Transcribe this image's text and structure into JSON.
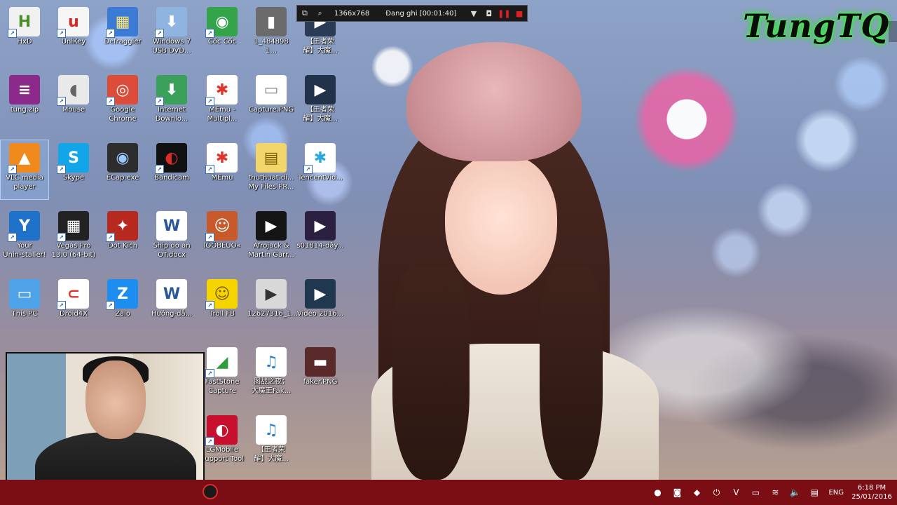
{
  "desktop": {
    "icons": [
      {
        "label": "HxD",
        "glyph": "H",
        "bg": "#f1f1f1",
        "fg": "#4a8f2a",
        "col": 0,
        "row": 0,
        "shortcut": true
      },
      {
        "label": "UniKey",
        "glyph": "u",
        "bg": "#f6f6f6",
        "fg": "#d22",
        "col": 1,
        "row": 0,
        "shortcut": true
      },
      {
        "label": "Defraggler",
        "glyph": "▦",
        "bg": "#3b7bd6",
        "fg": "#ffe36a",
        "col": 2,
        "row": 0,
        "shortcut": true
      },
      {
        "label": "Windows 7\nUSB DVD...",
        "glyph": "⬇",
        "bg": "#8fb4e0",
        "fg": "#fff",
        "col": 3,
        "row": 0,
        "shortcut": true
      },
      {
        "label": "Cốc Cốc",
        "glyph": "◉",
        "bg": "#33a44a",
        "fg": "#fff",
        "col": 4,
        "row": 0,
        "shortcut": true
      },
      {
        "label": "1_484898 1...",
        "glyph": "▮",
        "bg": "#6b6b6b",
        "fg": "#fff",
        "col": 5,
        "row": 0,
        "shortcut": false
      },
      {
        "label": "【王者荣\n耀】大魔...",
        "glyph": "▶",
        "bg": "#2a3b55",
        "fg": "#fff",
        "col": 6,
        "row": 0,
        "shortcut": false
      },
      {
        "label": "tung.zip",
        "glyph": "≡",
        "bg": "#8b2a8b",
        "fg": "#fff",
        "col": 0,
        "row": 1,
        "shortcut": false
      },
      {
        "label": "Mouse",
        "glyph": "◖",
        "bg": "#e9e9e9",
        "fg": "#666",
        "col": 1,
        "row": 1,
        "shortcut": true
      },
      {
        "label": "Google\nChrome",
        "glyph": "◎",
        "bg": "#dd4b39",
        "fg": "#fff",
        "col": 2,
        "row": 1,
        "shortcut": true
      },
      {
        "label": "Internet\nDownlo...",
        "glyph": "⬇",
        "bg": "#3aa05a",
        "fg": "#fff",
        "col": 3,
        "row": 1,
        "shortcut": true
      },
      {
        "label": "MEmu -\nMultipl...",
        "glyph": "✱",
        "bg": "#ffffff",
        "fg": "#e0342a",
        "col": 4,
        "row": 1,
        "shortcut": true
      },
      {
        "label": "Capture.PNG",
        "glyph": "▭",
        "bg": "#ffffff",
        "fg": "#888",
        "col": 5,
        "row": 1,
        "shortcut": false
      },
      {
        "label": "【王者荣\n耀】大魔...",
        "glyph": "▶",
        "bg": "#22324a",
        "fg": "#fff",
        "col": 6,
        "row": 1,
        "shortcut": false
      },
      {
        "label": "VLC media\nplayer",
        "glyph": "▲",
        "bg": "#f08a1c",
        "fg": "#fff",
        "col": 0,
        "row": 2,
        "shortcut": true,
        "selected": true
      },
      {
        "label": "Skype",
        "glyph": "S",
        "bg": "#12a5e8",
        "fg": "#fff",
        "col": 1,
        "row": 2,
        "shortcut": true
      },
      {
        "label": "ECap.exe",
        "glyph": "◉",
        "bg": "#2d2d2d",
        "fg": "#9cc7ff",
        "col": 2,
        "row": 2,
        "shortcut": false
      },
      {
        "label": "Bandicam",
        "glyph": "◐",
        "bg": "#111111",
        "fg": "#e12a2a",
        "col": 3,
        "row": 2,
        "shortcut": true
      },
      {
        "label": "MEmu",
        "glyph": "✱",
        "bg": "#ffffff",
        "fg": "#e0342a",
        "col": 4,
        "row": 2,
        "shortcut": true
      },
      {
        "label": "thuthuat.di...\nMy Files PR...",
        "glyph": "▤",
        "bg": "#f2d56b",
        "fg": "#7a5b00",
        "col": 5,
        "row": 2,
        "shortcut": false
      },
      {
        "label": "TencentVid...",
        "glyph": "✱",
        "bg": "#ffffff",
        "fg": "#27a8e0",
        "col": 6,
        "row": 2,
        "shortcut": true
      },
      {
        "label": "Your\nUnin-staller!",
        "glyph": "Y",
        "bg": "#1f72c9",
        "fg": "#fff",
        "col": 0,
        "row": 3,
        "shortcut": true
      },
      {
        "label": "Vegas Pro\n13.0 (64-bit)",
        "glyph": "▦",
        "bg": "#222222",
        "fg": "#fff",
        "col": 1,
        "row": 3,
        "shortcut": true
      },
      {
        "label": "Dot Kich",
        "glyph": "✦",
        "bg": "#b7281e",
        "fg": "#fff",
        "col": 2,
        "row": 3,
        "shortcut": true
      },
      {
        "label": "Ship do an\nOT.docx",
        "glyph": "W",
        "bg": "#ffffff",
        "fg": "#2b579a",
        "col": 3,
        "row": 3,
        "shortcut": false
      },
      {
        "label": "lÔÕBEUO«",
        "glyph": "☺",
        "bg": "#c7592a",
        "fg": "#fff",
        "col": 4,
        "row": 3,
        "shortcut": true
      },
      {
        "label": "Afrojack &\nMartin Garr...",
        "glyph": "▶",
        "bg": "#151515",
        "fg": "#fff",
        "col": 5,
        "row": 3,
        "shortcut": false
      },
      {
        "label": "s01814-dây...",
        "glyph": "▶",
        "bg": "#2b2040",
        "fg": "#fff",
        "col": 6,
        "row": 3,
        "shortcut": false
      },
      {
        "label": "This PC",
        "glyph": "▭",
        "bg": "#4fa3e8",
        "fg": "#fff",
        "col": 0,
        "row": 4,
        "shortcut": false
      },
      {
        "label": "Droid4X",
        "glyph": "⊂",
        "bg": "#ffffff",
        "fg": "#e0342a",
        "col": 1,
        "row": 4,
        "shortcut": true
      },
      {
        "label": "Zalo",
        "glyph": "Z",
        "bg": "#1d8ef0",
        "fg": "#fff",
        "col": 2,
        "row": 4,
        "shortcut": true
      },
      {
        "label": "Hướng-dẫ...",
        "glyph": "W",
        "bg": "#ffffff",
        "fg": "#2b579a",
        "col": 3,
        "row": 4,
        "shortcut": false
      },
      {
        "label": "Troll FB",
        "glyph": "☺",
        "bg": "#f5d400",
        "fg": "#7a5b00",
        "col": 4,
        "row": 4,
        "shortcut": true
      },
      {
        "label": "12627316_1...",
        "glyph": "▶",
        "bg": "#d8d8d8",
        "fg": "#333",
        "col": 5,
        "row": 4,
        "shortcut": false
      },
      {
        "label": "Video 2016...",
        "glyph": "▶",
        "bg": "#20384f",
        "fg": "#fff",
        "col": 6,
        "row": 4,
        "shortcut": false
      },
      {
        "label": "FastStone\nCapture",
        "glyph": "◢",
        "bg": "#ffffff",
        "fg": "#2e9e3a",
        "col": 4,
        "row": 5,
        "shortcut": true
      },
      {
        "label": "图战之夜：\n大魔王Fak...",
        "glyph": "♫",
        "bg": "#ffffff",
        "fg": "#2a7cd4",
        "col": 5,
        "row": 5,
        "shortcut": false
      },
      {
        "label": "faker.PNG",
        "glyph": "▬",
        "bg": "#5a2a2a",
        "fg": "#fff",
        "col": 6,
        "row": 5,
        "shortcut": false
      },
      {
        "label": "LGMobile\nSupport Tool",
        "glyph": "◐",
        "bg": "#c8102e",
        "fg": "#fff",
        "col": 4,
        "row": 6,
        "shortcut": true
      },
      {
        "label": "【王者荣\n耀】大魔...",
        "glyph": "♫",
        "bg": "#ffffff",
        "fg": "#2a7cd4",
        "col": 5,
        "row": 6,
        "shortcut": false
      }
    ]
  },
  "recorder": {
    "resolution": "1366x768",
    "status": "Đang ghi [00:01:40]"
  },
  "watermark": "TungTQ",
  "tray": {
    "language": "ENG",
    "time": "6:18 PM",
    "date": "25/01/2016"
  }
}
